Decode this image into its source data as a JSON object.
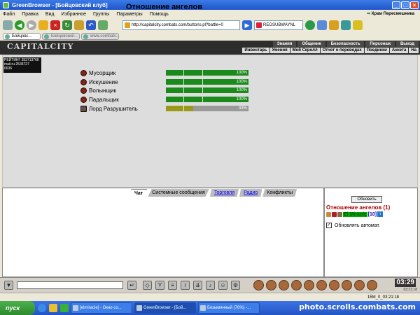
{
  "window": {
    "title": "GreenBrowser - [Бойцовский клуб]",
    "buttons": [
      "_",
      "□",
      "×"
    ]
  },
  "menubar": [
    "Файл",
    "Правка",
    "Вид",
    "Избранное",
    "Группы",
    "Параметры",
    "Помощь"
  ],
  "toolbar": {
    "address": "http://capitalcity.combats.com/buttons.pl?battle=0",
    "search": "REGSUBWAYNL"
  },
  "browser_tabs": [
    "Бойцовс...",
    "Бойцовский...",
    "www.combats..."
  ],
  "game_header": {
    "logo": "CAPITALCITY",
    "nav_top": [
      "Знания",
      "Общение",
      "Безопасность",
      "Персонаж",
      "Выход"
    ],
    "nav_bottom": [
      "Инвентарь",
      "Умения",
      "Мой Скролл",
      "Отчет о переводах",
      "Поединки",
      "Анкета",
      "На"
    ]
  },
  "main": {
    "title": "Отношение ангелов",
    "temple_link": "Храм Пересмешника",
    "angels": [
      {
        "name": "Мусорщик",
        "percent_label": "100%",
        "level": 1.0,
        "color": "#1a8a1a"
      },
      {
        "name": "Искушение",
        "percent_label": "100%",
        "level": 1.0,
        "color": "#1a8a1a"
      },
      {
        "name": "Волынщик",
        "percent_label": "100%",
        "level": 1.0,
        "color": "#1a8a1a"
      },
      {
        "name": "Падальщик",
        "percent_label": "100%",
        "level": 1.0,
        "color": "#1a8a1a"
      },
      {
        "name": "Лорд Разрушитель",
        "percent_label": "33%",
        "level": 0.33,
        "color": "#9a9a1a"
      }
    ],
    "counter": {
      "line1": "РЕЙТИНГ 35371376К",
      "line2": "mail.ru 2536727",
      "line3": "6636"
    }
  },
  "chat": {
    "tabs": [
      "Чат",
      "Системные сообщения",
      "Торговля",
      "Радио",
      "Конфликты"
    ]
  },
  "side": {
    "refresh_label": "Обновить",
    "title": "Отношение ангелов (1)",
    "user_name": "El Miracle",
    "user_level": "[10]",
    "user_badge": "i",
    "auto_label": "Обновлять автомат."
  },
  "gamebar": {
    "clock": "03:29",
    "clock_sub": "03:21:18"
  },
  "statusbar": {
    "time": "15M_0_03:21:18"
  },
  "taskbar": {
    "start": "пуск",
    "items": [
      "[elmiracle] - Окно со...",
      "GreenBrowser - [Бой...",
      "Безымянный (76%) -..."
    ],
    "watermark": "photo.scrolls.combats.com"
  }
}
